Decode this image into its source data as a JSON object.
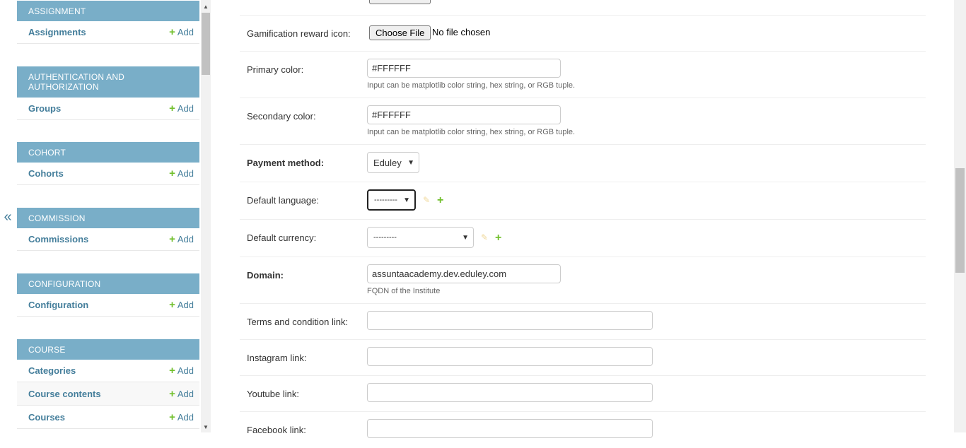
{
  "sidebar": {
    "toggle_label": "«",
    "add_label": "Add",
    "modules": [
      {
        "caption": "Assignment",
        "items": [
          {
            "label": "Assignments"
          }
        ]
      },
      {
        "caption": "Authentication and Authorization",
        "items": [
          {
            "label": "Groups"
          }
        ]
      },
      {
        "caption": "Cohort",
        "items": [
          {
            "label": "Cohorts"
          }
        ]
      },
      {
        "caption": "Commission",
        "items": [
          {
            "label": "Commissions"
          }
        ]
      },
      {
        "caption": "Configuration",
        "items": [
          {
            "label": "Configuration"
          }
        ]
      },
      {
        "caption": "Course",
        "items": [
          {
            "label": "Categories"
          },
          {
            "label": "Course contents"
          },
          {
            "label": "Courses"
          }
        ]
      }
    ]
  },
  "form": {
    "gamification": {
      "label": "Gamification reward icon:",
      "button_label": "Choose File",
      "status": "No file chosen"
    },
    "primary_color": {
      "label": "Primary color:",
      "value": "#FFFFFF",
      "help": "Input can be matplotlib color string, hex string, or RGB tuple."
    },
    "secondary_color": {
      "label": "Secondary color:",
      "value": "#FFFFFF",
      "help": "Input can be matplotlib color string, hex string, or RGB tuple."
    },
    "payment_method": {
      "label": "Payment method:",
      "value": "Eduley"
    },
    "default_language": {
      "label": "Default language:",
      "value": "---------"
    },
    "default_currency": {
      "label": "Default currency:",
      "value": "---------"
    },
    "domain": {
      "label": "Domain:",
      "value": "assuntaacademy.dev.eduley.com",
      "help": "FQDN of the Institute"
    },
    "terms_link": {
      "label": "Terms and condition link:",
      "value": ""
    },
    "instagram_link": {
      "label": "Instagram link:",
      "value": ""
    },
    "youtube_link": {
      "label": "Youtube link:",
      "value": ""
    },
    "facebook_link": {
      "label": "Facebook link:",
      "value": ""
    }
  },
  "colors": {
    "module_header": "#79aec8",
    "link": "#447e9b",
    "add_green": "#70bf2b"
  },
  "icons": {
    "add": "plus-icon",
    "edit": "pencil-icon",
    "toggle": "double-chevron-left-icon"
  }
}
